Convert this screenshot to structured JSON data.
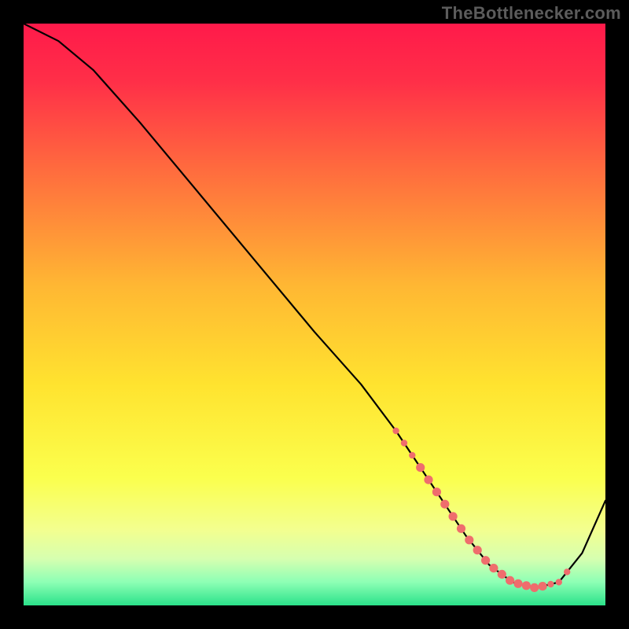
{
  "watermark": "TheBottlenecker.com",
  "colors": {
    "frame": "#000000",
    "curve": "#000000",
    "marker": "#ef6d6d",
    "watermark": "#5c5c5c",
    "gradient_top": "#ff1a4a",
    "gradient_mid": "#ffd22b",
    "gradient_low": "#f8ff8a",
    "gradient_green": "#29e07a"
  },
  "chart_data": {
    "type": "line",
    "title": "",
    "xlabel": "",
    "ylabel": "",
    "xlim": [
      0,
      100
    ],
    "ylim": [
      0,
      100
    ],
    "series": [
      {
        "name": "curve",
        "x": [
          0,
          6,
          12,
          20,
          30,
          40,
          50,
          58,
          64,
          68,
          72,
          76,
          80,
          84,
          88,
          92,
          96,
          100
        ],
        "y": [
          100,
          97,
          92,
          83,
          71,
          59,
          47,
          38,
          30,
          24,
          18,
          12,
          7,
          4,
          3,
          4,
          9,
          18
        ]
      }
    ],
    "markers": {
      "name": "highlight-band",
      "x_range": [
        64,
        94
      ],
      "y": 4
    }
  }
}
